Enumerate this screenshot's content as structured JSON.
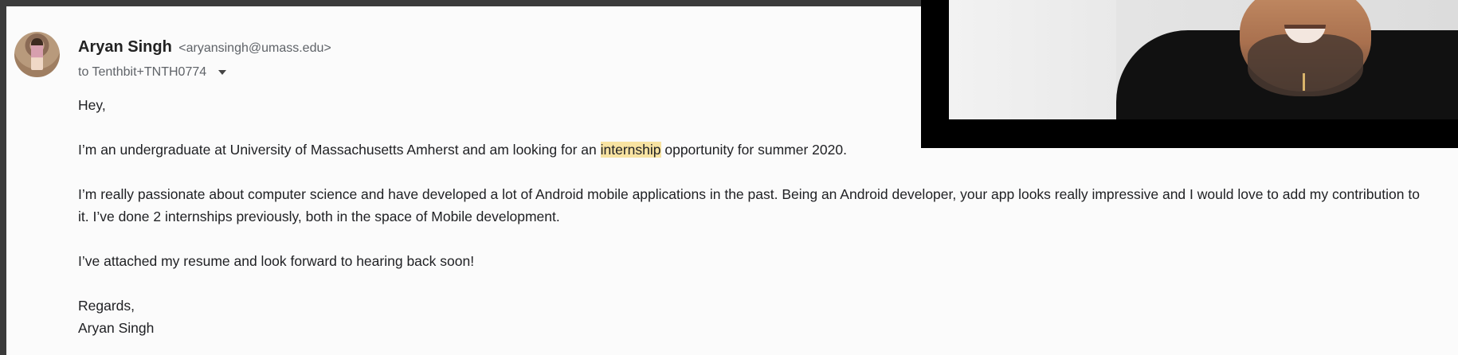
{
  "email": {
    "sender_name": "Aryan Singh",
    "sender_email": "<aryansingh@umass.edu>",
    "recipient": "to Tenthbit+TNTH0774",
    "greeting": "Hey,",
    "paragraph_1_before": "I’m an undergraduate at University of Massachusetts Amherst and am looking for an ",
    "paragraph_1_highlight": "internship",
    "paragraph_1_after": " opportunity for summer 2020.",
    "paragraph_2": "I’m really passionate about computer science and have developed a lot of Android mobile applications in the past. Being an Android developer, your app looks really impressive and I would love to add my contribution to it. I’ve done 2 internships previously, both in the space of Mobile development.",
    "paragraph_3": "I’ve attached my resume and look forward to hearing back soon!",
    "signoff": "Regards,",
    "signature": "Aryan Singh"
  },
  "icons": {
    "recipient_dropdown": "chevron-down-icon",
    "avatar": "profile-photo"
  },
  "colors": {
    "highlight": "#f8e3a2",
    "email_background": "#fbfbfb"
  }
}
